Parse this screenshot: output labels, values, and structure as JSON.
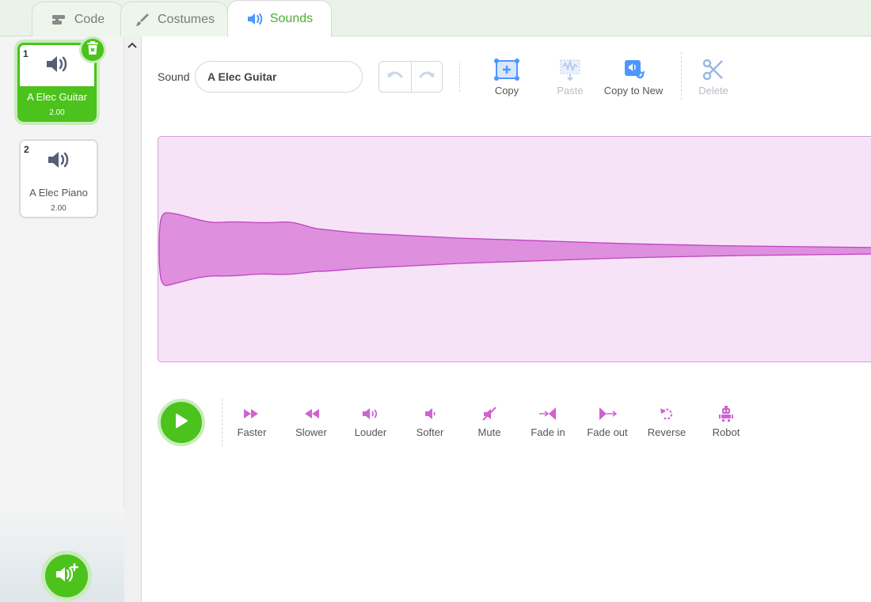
{
  "tabs": [
    {
      "label": "Code",
      "icon": "code-blocks-icon"
    },
    {
      "label": "Costumes",
      "icon": "paintbrush-icon"
    },
    {
      "label": "Sounds",
      "icon": "speaker-icon",
      "active": true
    }
  ],
  "sound_list": [
    {
      "index": "1",
      "name": "A Elec Guitar",
      "duration": "2.00",
      "selected": true
    },
    {
      "index": "2",
      "name": "A Elec Piano",
      "duration": "2.00",
      "selected": false
    }
  ],
  "editor": {
    "sound_label": "Sound",
    "sound_name": "A Elec Guitar",
    "toolbar": {
      "copy": "Copy",
      "paste": "Paste",
      "copy_to_new": "Copy to New",
      "delete": "Delete"
    }
  },
  "effects": [
    {
      "label": "Faster",
      "icon": "faster-icon"
    },
    {
      "label": "Slower",
      "icon": "slower-icon"
    },
    {
      "label": "Louder",
      "icon": "louder-icon"
    },
    {
      "label": "Softer",
      "icon": "softer-icon"
    },
    {
      "label": "Mute",
      "icon": "mute-icon"
    },
    {
      "label": "Fade in",
      "icon": "fade-in-icon"
    },
    {
      "label": "Fade out",
      "icon": "fade-out-icon"
    },
    {
      "label": "Reverse",
      "icon": "reverse-icon"
    },
    {
      "label": "Robot",
      "icon": "robot-icon"
    }
  ],
  "colors": {
    "accent_green": "#4cc21c",
    "accent_blue": "#4c97ff",
    "effect_magenta": "#cf63cf",
    "wave_fill": "#de8fde",
    "wave_bg": "#f7e3f7"
  }
}
